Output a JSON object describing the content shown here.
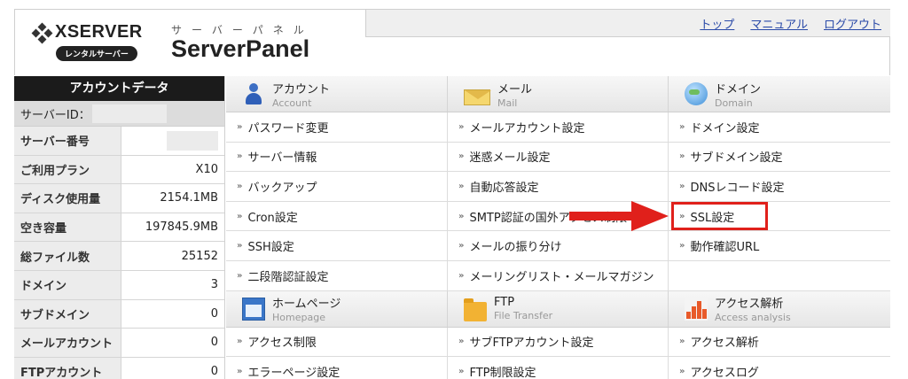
{
  "header": {
    "logo_text": "XSERVER",
    "logo_badge": "レンタルサーバー",
    "panel_kana": "サーバーパネル",
    "panel_name": "ServerPanel",
    "links": [
      "トップ",
      "マニュアル",
      "ログアウト"
    ]
  },
  "account": {
    "title": "アカウントデータ",
    "server_id_label": "サーバーID：",
    "rows": [
      {
        "label": "サーバー番号",
        "value": ""
      },
      {
        "label": "ご利用プラン",
        "value": "X10"
      },
      {
        "label": "ディスク使用量",
        "value": "2154.1MB"
      },
      {
        "label": "空き容量",
        "value": "197845.9MB"
      },
      {
        "label": "総ファイル数",
        "value": "25152"
      },
      {
        "label": "ドメイン",
        "value": "3"
      },
      {
        "label": "サブドメイン",
        "value": "0"
      },
      {
        "label": "メールアカウント",
        "value": "0"
      },
      {
        "label": "FTPアカウント",
        "value": "0"
      }
    ]
  },
  "sections_top": [
    {
      "name": "アカウント",
      "sub": "Account",
      "icon": "person-icon"
    },
    {
      "name": "メール",
      "sub": "Mail",
      "icon": "mail-icon"
    },
    {
      "name": "ドメイン",
      "sub": "Domain",
      "icon": "globe-icon"
    }
  ],
  "links_top": [
    [
      "パスワード変更",
      "メールアカウント設定",
      "ドメイン設定"
    ],
    [
      "サーバー情報",
      "迷惑メール設定",
      "サブドメイン設定"
    ],
    [
      "バックアップ",
      "自動応答設定",
      "DNSレコード設定"
    ],
    [
      "Cron設定",
      "SMTP認証の国外アクセス制限",
      "SSL設定"
    ],
    [
      "SSH設定",
      "メールの振り分け",
      "動作確認URL"
    ],
    [
      "二段階認証設定",
      "メーリングリスト・メールマガジン",
      ""
    ]
  ],
  "sections_bottom": [
    {
      "name": "ホームページ",
      "sub": "Homepage",
      "icon": "window-icon"
    },
    {
      "name": "FTP",
      "sub": "File Transfer",
      "icon": "folder-icon"
    },
    {
      "name": "アクセス解析",
      "sub": "Access analysis",
      "icon": "chart-icon"
    }
  ],
  "links_bottom": [
    [
      "アクセス制限",
      "サブFTPアカウント設定",
      "アクセス解析"
    ],
    [
      "エラーページ設定",
      "FTP制限設定",
      "アクセスログ"
    ]
  ],
  "colors": {
    "accent_link": "#2a4aa8",
    "highlight": "#e0201b"
  }
}
